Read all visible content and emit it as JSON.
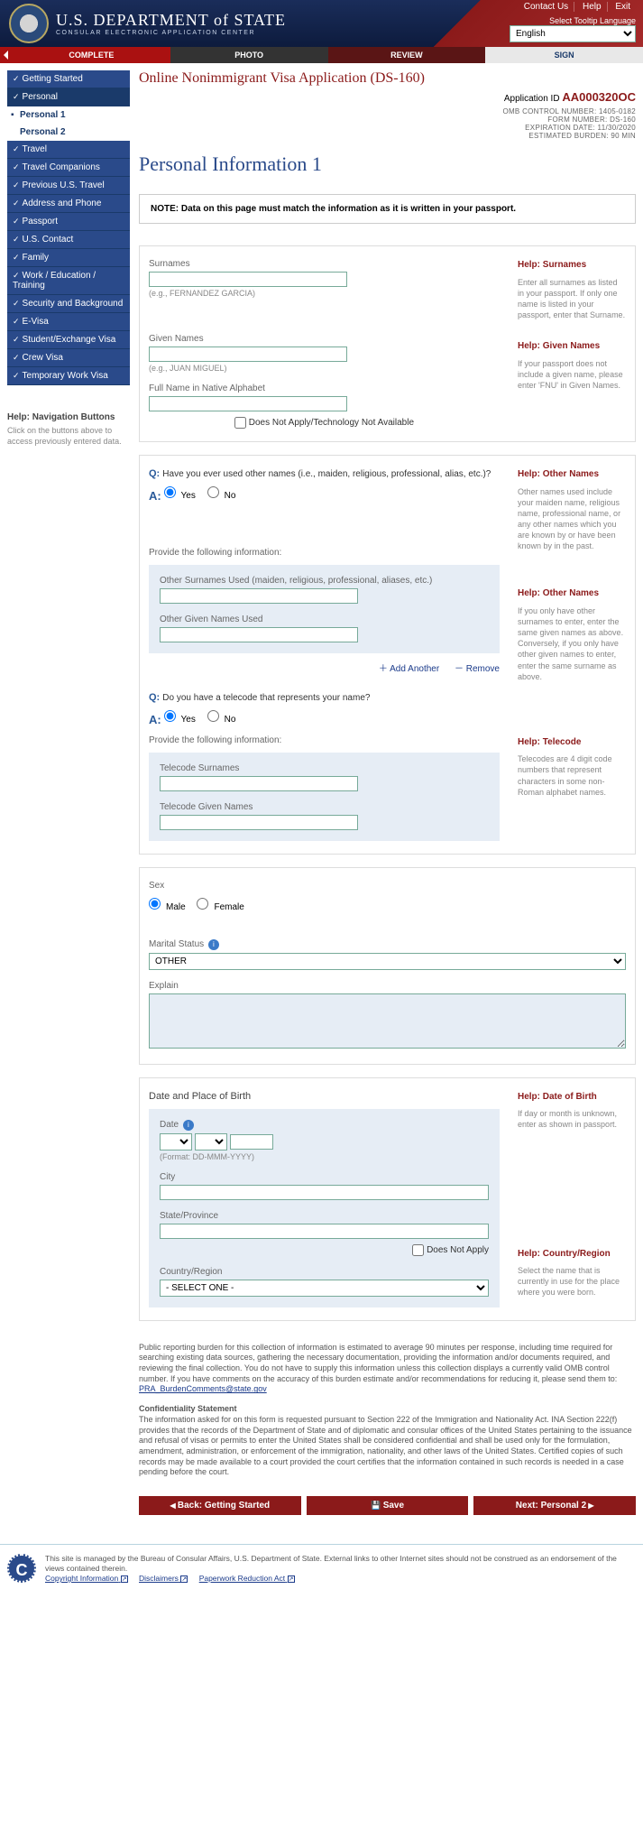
{
  "header": {
    "dept": "U.S. DEPARTMENT of STATE",
    "sub": "CONSULAR ELECTRONIC APPLICATION CENTER",
    "links": [
      "Contact Us",
      "Help",
      "Exit"
    ],
    "lang_label": "Select Tooltip Language",
    "lang_value": "English"
  },
  "tabs": {
    "complete": "COMPLETE",
    "photo": "PHOTO",
    "review": "REVIEW",
    "sign": "SIGN"
  },
  "nav": {
    "items": [
      "Getting Started",
      "Personal",
      "Travel",
      "Travel Companions",
      "Previous U.S. Travel",
      "Address and Phone",
      "Passport",
      "U.S. Contact",
      "Family",
      "Work / Education / Training",
      "Security and Background",
      "E-Visa",
      "Student/Exchange Visa",
      "Crew Visa",
      "Temporary Work Visa"
    ],
    "sub1": "Personal 1",
    "sub2": "Personal 2",
    "help_title": "Help: Navigation Buttons",
    "help_body": "Click on the buttons above to access previously entered data."
  },
  "page": {
    "title": "Online Nonimmigrant Visa Application (DS-160)",
    "appid_label": "Application ID",
    "appid": "AA000320OC",
    "meta": [
      "OMB CONTROL NUMBER:    1405-0182",
      "FORM NUMBER:       DS-160",
      "EXPIRATION DATE:  11/30/2020",
      "ESTIMATED BURDEN:      90 MIN"
    ],
    "section_title": "Personal Information 1",
    "note": "NOTE: Data on this page must match the information as it is written in your passport."
  },
  "fields": {
    "surnames_label": "Surnames",
    "surnames_hint": "(e.g., FERNANDEZ GARCIA)",
    "given_label": "Given Names",
    "given_hint": "(e.g., JUAN MIGUEL)",
    "native_label": "Full Name in Native Alphabet",
    "native_na": "Does Not Apply/Technology Not Available",
    "other_q": "Have you ever used other names (i.e., maiden, religious, professional, alias, etc.)?",
    "yes": "Yes",
    "no": "No",
    "provide": "Provide the following information:",
    "other_sur": "Other Surnames Used (maiden, religious, professional, aliases, etc.)",
    "other_given": "Other Given Names Used",
    "add": "Add Another",
    "remove": "Remove",
    "tele_q": "Do you have a telecode that represents your name?",
    "tele_sur": "Telecode Surnames",
    "tele_given": "Telecode Given Names",
    "sex": "Sex",
    "male": "Male",
    "female": "Female",
    "marital": "Marital Status",
    "marital_val": "OTHER",
    "explain": "Explain",
    "dob_title": "Date and Place of Birth",
    "date": "Date",
    "date_hint": "(Format: DD-MMM-YYYY)",
    "city": "City",
    "state": "State/Province",
    "dna": "Does Not Apply",
    "country": "Country/Region",
    "country_val": "- SELECT ONE -"
  },
  "help": {
    "surnames_t": "Help: Surnames",
    "surnames_b": "Enter all surnames as listed in your passport. If only one name is listed in your passport, enter that Surname.",
    "given_t": "Help: Given Names",
    "given_b": "If your passport does not include a given name, please enter 'FNU' in Given Names.",
    "other_t": "Help: Other Names",
    "other_b": "Other names used include your maiden name, religious name, professional name, or any other names which you are known by or have been known by in the past.",
    "other2_t": "Help: Other Names",
    "other2_b": "If you only have other surnames to enter, enter the same given names as above. Conversely, if you only have other given names to enter, enter the same surname as above.",
    "tele_t": "Help: Telecode",
    "tele_b": "Telecodes are 4 digit code numbers that represent characters in some non-Roman alphabet names.",
    "dob_t": "Help: Date of Birth",
    "dob_b": "If day or month is unknown, enter as shown in passport.",
    "country_t": "Help: Country/Region",
    "country_b": "Select the name that is currently in use for the place where you were born."
  },
  "burden": {
    "p1": "Public reporting burden for this collection of information is estimated to average 90 minutes per response, including time required for searching existing data sources, gathering the necessary documentation, providing the information and/or documents required, and reviewing the final collection. You do not have to supply this information unless this collection displays a currently valid OMB control number. If you have comments on the accuracy of this burden estimate and/or recommendations for reducing it, please send them to: ",
    "email": "PRA_BurdenComments@state.gov",
    "conf_h": "Confidentiality Statement",
    "conf_b": "The information asked for on this form is requested pursuant to Section 222 of the Immigration and Nationality Act. INA Section 222(f) provides that the records of the Department of State and of diplomatic and consular offices of the United States pertaining to the issuance and refusal of visas or permits to enter the United States shall be considered confidential and shall be used only for the formulation, amendment, administration, or enforcement of the immigration, nationality, and other laws of the United States. Certified copies of such records may be made available to a court provided the court certifies that the information contained in such records is needed in a case pending before the court."
  },
  "buttons": {
    "back": "Back: Getting Started",
    "save": "Save",
    "next": "Next: Personal 2"
  },
  "footer": {
    "text": "This site is managed by the Bureau of Consular Affairs, U.S. Department of State. External links to other Internet sites should not be construed as an endorsement of the views contained therein.",
    "links": [
      "Copyright Information",
      "Disclaimers",
      "Paperwork Reduction Act"
    ]
  }
}
